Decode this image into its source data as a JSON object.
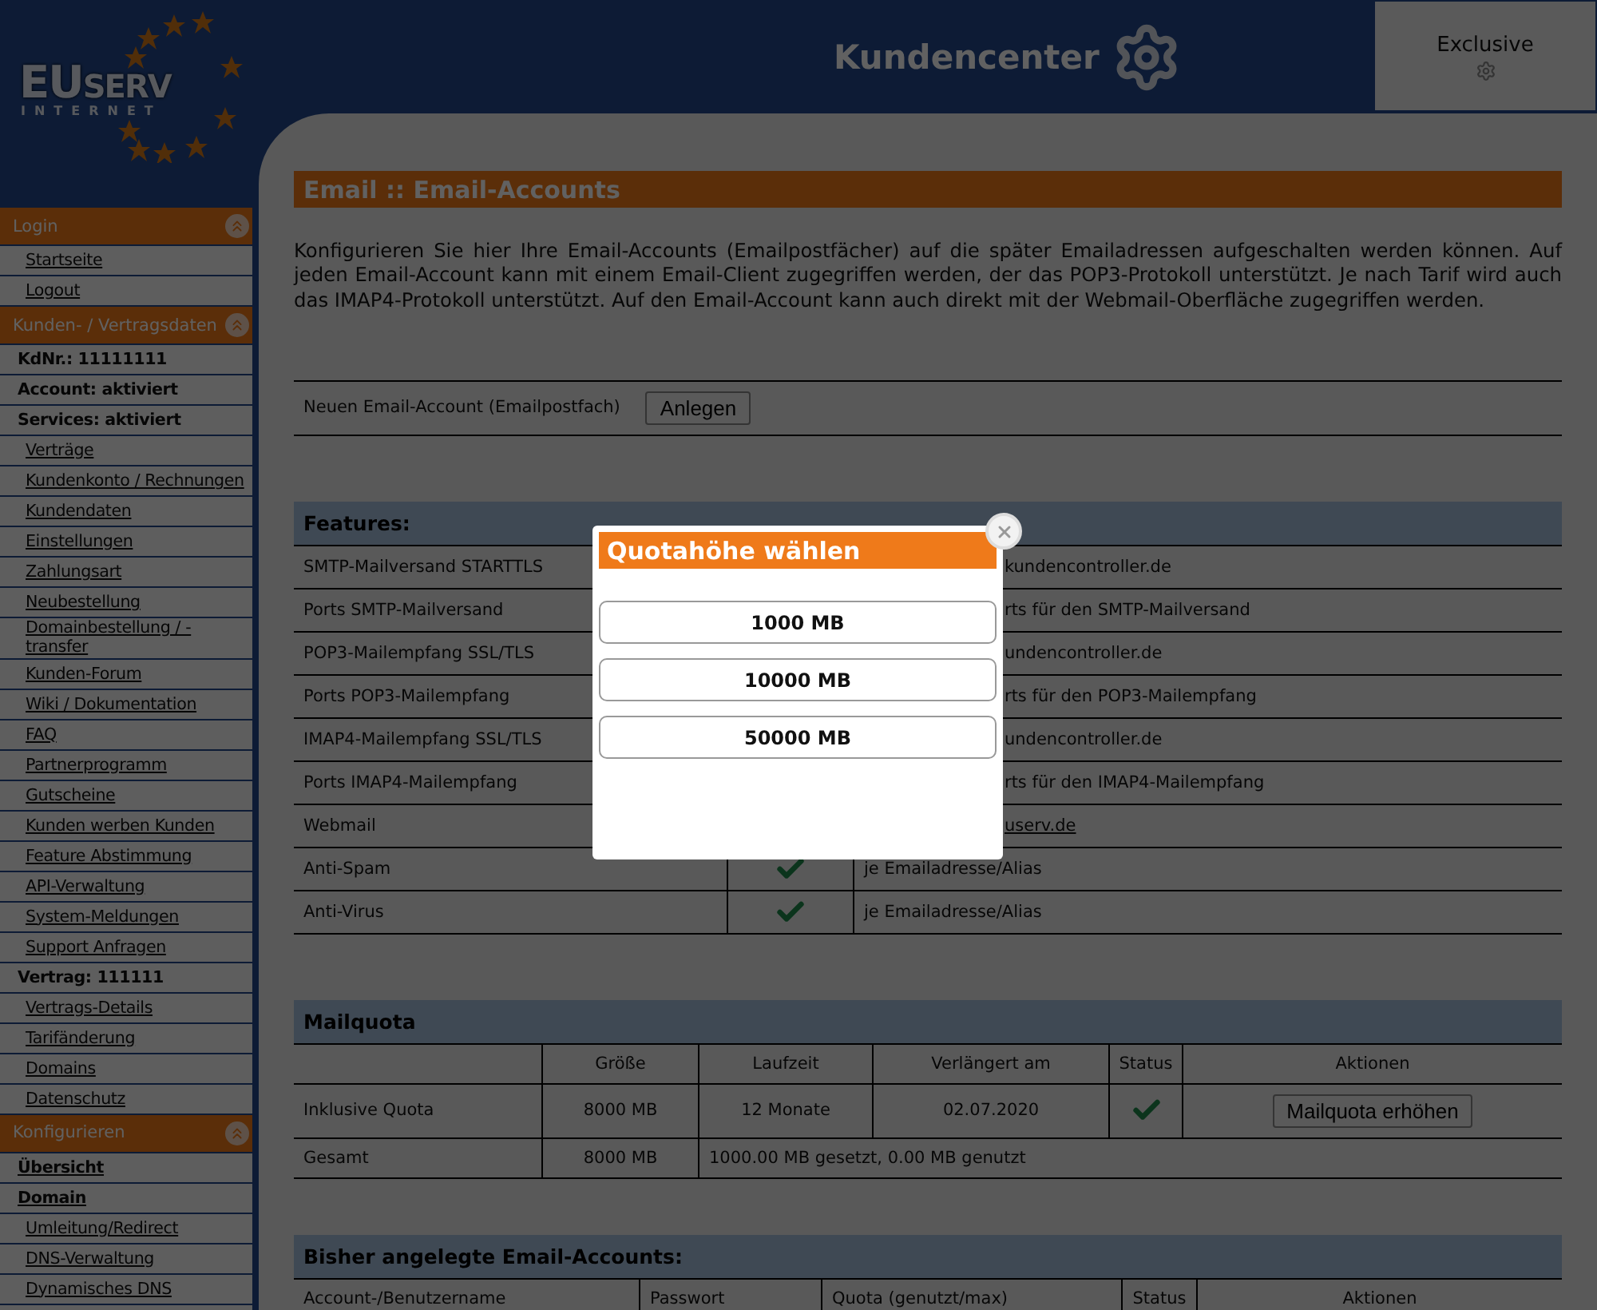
{
  "logo": {
    "big": "EU",
    "small": "SERV",
    "sub": "INTERNET"
  },
  "header": {
    "title": "Kundencenter",
    "plan": "Exclusive"
  },
  "sidebar": [
    {
      "kind": "header",
      "label": "Login"
    },
    {
      "kind": "link",
      "label": "Startseite"
    },
    {
      "kind": "link",
      "label": "Logout"
    },
    {
      "kind": "header",
      "label": "Kunden- / Vertragsdaten"
    },
    {
      "kind": "info",
      "label": "KdNr.: 11111111"
    },
    {
      "kind": "info",
      "label": "Account: aktiviert"
    },
    {
      "kind": "info",
      "label": "Services: aktiviert"
    },
    {
      "kind": "link",
      "label": "Verträge"
    },
    {
      "kind": "link",
      "label": "Kundenkonto / Rechnungen"
    },
    {
      "kind": "link",
      "label": "Kundendaten"
    },
    {
      "kind": "link",
      "label": "Einstellungen"
    },
    {
      "kind": "link",
      "label": "Zahlungsart"
    },
    {
      "kind": "link",
      "label": "Neubestellung"
    },
    {
      "kind": "link",
      "label": "Domainbestellung / -transfer"
    },
    {
      "kind": "link",
      "label": "Kunden-Forum"
    },
    {
      "kind": "link",
      "label": "Wiki / Dokumentation"
    },
    {
      "kind": "link",
      "label": "FAQ"
    },
    {
      "kind": "link",
      "label": "Partnerprogramm"
    },
    {
      "kind": "link",
      "label": "Gutscheine"
    },
    {
      "kind": "link",
      "label": "Kunden werben Kunden"
    },
    {
      "kind": "link",
      "label": "Feature Abstimmung"
    },
    {
      "kind": "link",
      "label": "API-Verwaltung"
    },
    {
      "kind": "link",
      "label": "System-Meldungen"
    },
    {
      "kind": "link",
      "label": "Support Anfragen"
    },
    {
      "kind": "info",
      "label": "Vertrag: 111111"
    },
    {
      "kind": "link",
      "label": "Vertrags-Details"
    },
    {
      "kind": "link",
      "label": "Tarifänderung"
    },
    {
      "kind": "link",
      "label": "Domains"
    },
    {
      "kind": "link",
      "label": "Datenschutz"
    },
    {
      "kind": "header",
      "label": "Konfigurieren"
    },
    {
      "kind": "heading",
      "label": "Übersicht"
    },
    {
      "kind": "heading",
      "label": "Domain"
    },
    {
      "kind": "link",
      "label": "Umleitung/Redirect"
    },
    {
      "kind": "link",
      "label": "DNS-Verwaltung"
    },
    {
      "kind": "link",
      "label": "Dynamisches DNS"
    }
  ],
  "page_title": "Email :: Email-Accounts",
  "intro": "Konfigurieren Sie hier Ihre Email-Accounts (Emailpostfächer) auf die später Emailadressen aufgeschalten werden können. Auf jeden Email-Account kann mit einem Email-Client zugegriffen werden, der das POP3-Protokoll unterstützt. Je nach Tarif wird auch das IMAP4-Protokoll unterstützt. Auf den Email-Account kann auch direkt mit der Webmail-Oberfläche zugegriffen werden.",
  "new_account": {
    "label": "Neuen Email-Account (Emailpostfach)",
    "button": "Anlegen"
  },
  "features": {
    "title": "Features:",
    "rows": [
      {
        "name": "SMTP-Mailversand STARTTLS",
        "covered": true,
        "check": false,
        "link": false,
        "note": "kundencontroller.de"
      },
      {
        "name": "Ports SMTP-Mailversand",
        "covered": true,
        "check": false,
        "link": false,
        "note": "rts für den SMTP-Mailversand"
      },
      {
        "name": "POP3-Mailempfang SSL/TLS",
        "covered": true,
        "check": false,
        "link": false,
        "note": "undencontroller.de"
      },
      {
        "name": "Ports POP3-Mailempfang",
        "covered": true,
        "check": false,
        "link": false,
        "note": "rts für den POP3-Mailempfang"
      },
      {
        "name": "IMAP4-Mailempfang SSL/TLS",
        "covered": true,
        "check": false,
        "link": false,
        "note": "undencontroller.de"
      },
      {
        "name": "Ports IMAP4-Mailempfang",
        "covered": true,
        "check": false,
        "link": false,
        "note": "rts für den IMAP4-Mailempfang"
      },
      {
        "name": "Webmail",
        "covered": true,
        "check": false,
        "link": true,
        "note": "userv.de"
      },
      {
        "name": "Anti-Spam",
        "covered": false,
        "check": true,
        "link": false,
        "note": "je Emailadresse/Alias"
      },
      {
        "name": "Anti-Virus",
        "covered": false,
        "check": true,
        "link": false,
        "note": "je Emailadresse/Alias"
      }
    ]
  },
  "mailquota": {
    "title": "Mailquota",
    "columns": [
      "Größe",
      "Laufzeit",
      "Verlängert am",
      "Status",
      "Aktionen"
    ],
    "row": {
      "name": "Inklusive Quota",
      "size": "8000 MB",
      "term": "12 Monate",
      "renewed": "02.07.2020",
      "status_ok": true,
      "action": "Mailquota erhöhen"
    },
    "total": {
      "name": "Gesamt",
      "size": "8000 MB",
      "usage": "1000.00 MB gesetzt, 0.00 MB genutzt"
    }
  },
  "accounts": {
    "title": "Bisher angelegte Email-Accounts:",
    "columns": [
      "Account-/Benutzername",
      "Passwort",
      "Quota (genutzt/max)",
      "Status",
      "Aktionen"
    ]
  },
  "dialog": {
    "open": true,
    "title": "Quotahöhe wählen",
    "options": [
      "1000 MB",
      "10000 MB",
      "50000 MB"
    ]
  }
}
